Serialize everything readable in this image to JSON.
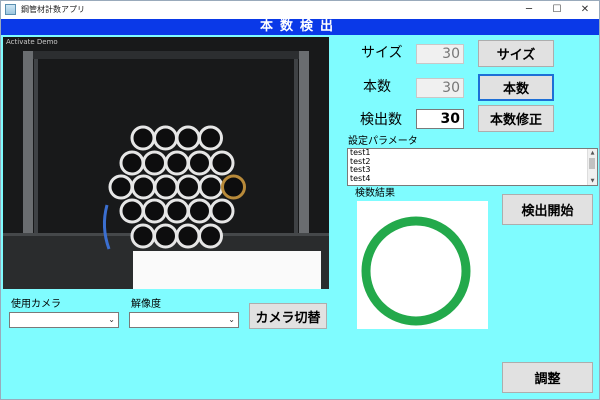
{
  "window": {
    "title": "鋼管材計数アプリ",
    "minimize": "─",
    "maximize": "☐",
    "close": "✕"
  },
  "banner": {
    "title": "本数検出"
  },
  "camera": {
    "overlay_text": "Activate Demo"
  },
  "fields": {
    "size": {
      "label": "サイズ",
      "value": "30",
      "button": "サイズ"
    },
    "count": {
      "label": "本数",
      "value": "30",
      "button": "本数"
    },
    "detected": {
      "label": "検出数",
      "value": "30",
      "button": "本数修正"
    }
  },
  "params": {
    "label": "設定パラメータ",
    "items": [
      "test1",
      "test2",
      "test3",
      "test4"
    ]
  },
  "result": {
    "label": "検数結果",
    "ring_color": "#23a94b"
  },
  "buttons": {
    "start": "検出開始",
    "adjust": "調整",
    "switch_camera": "カメラ切替"
  },
  "camera_select": {
    "label": "使用カメラ",
    "value": ""
  },
  "resolution_select": {
    "label": "解像度",
    "value": ""
  },
  "colors": {
    "banner": "#0a39e8",
    "background": "#7ffcff"
  }
}
